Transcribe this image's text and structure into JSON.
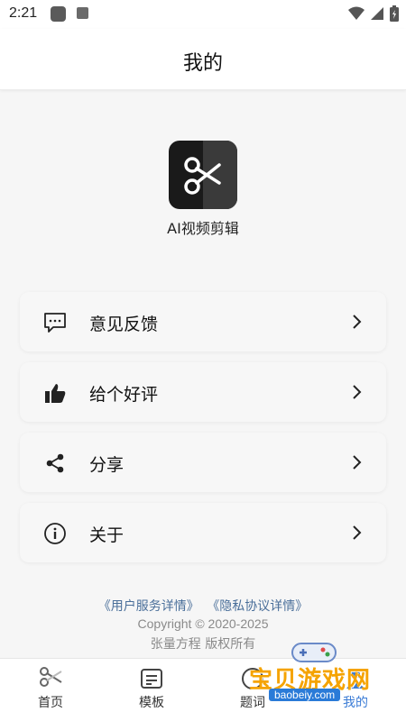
{
  "status_bar": {
    "time": "2:21",
    "icons": [
      "app-icon",
      "a-icon",
      "wifi-icon",
      "signal-icon",
      "battery-icon"
    ]
  },
  "header": {
    "title": "我的"
  },
  "app": {
    "name": "AI视频剪辑",
    "logo_icon": "scissors-icon"
  },
  "menu": [
    {
      "label": "意见反馈",
      "icon": "feedback-icon"
    },
    {
      "label": "给个好评",
      "icon": "thumbs-up-icon"
    },
    {
      "label": "分享",
      "icon": "share-icon"
    },
    {
      "label": "关于",
      "icon": "info-icon"
    }
  ],
  "footer": {
    "user_agreement": "《用户服务详情》",
    "privacy_policy": "《隐私协议详情》",
    "copyright": "Copyright © 2020-2025",
    "owner": "张量方程  版权所有"
  },
  "bottom_nav": [
    {
      "label": "首页",
      "icon": "scissors-icon"
    },
    {
      "label": "模板",
      "icon": "template-icon"
    },
    {
      "label": "题词",
      "icon": "prompter-icon"
    },
    {
      "label": "我的",
      "icon": "profile-icon"
    }
  ],
  "watermark": {
    "text": "宝贝游戏网",
    "url": "baobeiy.com"
  },
  "colors": {
    "accent": "#3a7bd5",
    "link": "#4a6f9a",
    "watermark": "#f5a300"
  }
}
